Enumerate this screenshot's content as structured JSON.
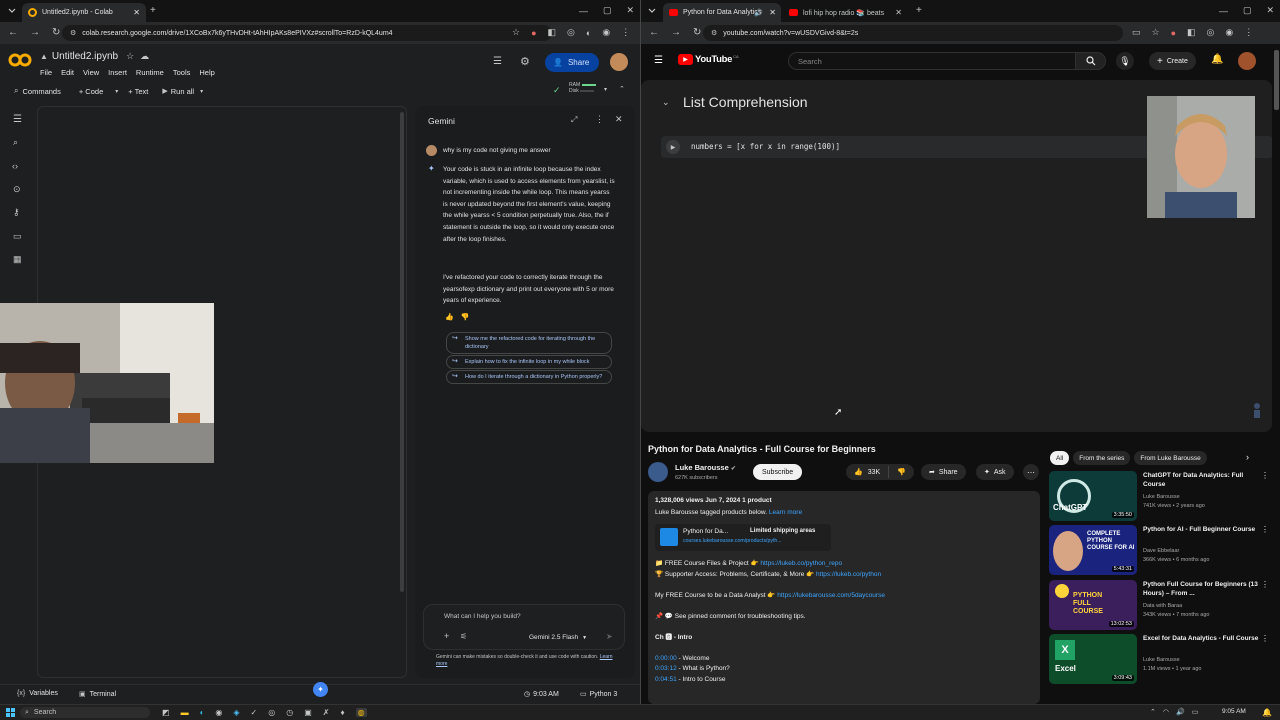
{
  "left_browser": {
    "tabs": [
      {
        "label": "Untitled2.ipynb - Colab"
      }
    ],
    "url": "colab.research.google.com/drive/1XCoBx7k6yTHvDHt-tAhHIpAKs8ePIVXz#scrollTo=RzD-kQL4um4",
    "colab": {
      "filename": "Untitled2.ipynb",
      "menu": [
        "File",
        "Edit",
        "View",
        "Insert",
        "Runtime",
        "Tools",
        "Help"
      ],
      "share_label": "Share",
      "toolbar": {
        "commands": "Commands",
        "code": "+ Code",
        "text": "+ Text",
        "run_all": "Run all"
      },
      "ram_label": "RAM",
      "disk_label": "Disk",
      "status_bar": {
        "variables": "Variables",
        "terminal": "Terminal",
        "time": "9:03 AM",
        "runtime": "Python 3"
      }
    },
    "gemini": {
      "title": "Gemini",
      "user_prompt": "why is my code not giving me answer",
      "response_p1": "Your code is stuck in an infinite loop because the index variable, which is used to access elements from yearslist, is not incrementing inside the while loop. This means yearss is never updated beyond the first element's value, keeping the while yearss < 5 condition perpetually true. Also, the if statement is outside the loop, so it would only execute once after the loop finishes.",
      "response_p2": "I've refactored your code to correctly iterate through the yearsofexp dictionary and print out everyone with 5 or more years of experience.",
      "suggestions": [
        "Show me the refactored code for iterating through the dictionary",
        "Explain how to fix the infinite loop in my while block",
        "How do I iterate through a dictionary in Python properly?"
      ],
      "input_placeholder": "What can I help you build?",
      "model": "Gemini 2.5 Flash",
      "disclaimer": "Gemini can make mistakes so double-check it and use code with caution.",
      "learn_more": "Learn more"
    }
  },
  "right_browser": {
    "tabs": [
      {
        "label": "Python for Data Analytics"
      },
      {
        "label": "lofi hip hop radio 📚 beats"
      }
    ],
    "url": "youtube.com/watch?v=wUSDVGivd-8&t=2s",
    "youtube": {
      "search_placeholder": "Search",
      "create_label": "Create",
      "logo_text": "YouTube",
      "logo_country": "CA",
      "video_heading": "List Comprehension",
      "code_line": "numbers = [x for x in range(100)]",
      "video_title": "Python for Data Analytics - Full Course for Beginners",
      "channel": "Luke Barousse",
      "subscribers": "627K subscribers",
      "subscribe_label": "Subscribe",
      "likes": "33K",
      "share_label": "Share",
      "ask_label": "Ask",
      "views_date": "1,328,006 views  Jun 7, 2024  1 product",
      "products_line": "Luke Barousse tagged products below.",
      "learn_more": "Learn more",
      "product_name": "Python for Da...",
      "product_ship": "Limited shipping areas",
      "product_url": "courses.lukebarousse.com/products/pyth...",
      "desc_lines": [
        {
          "prefix": "📁 FREE Course Files & Project 👉 ",
          "link": "https://lukeb.co/python_repo"
        },
        {
          "prefix": "🏆 Supporter Access: Problems, Certificate, & More 👉 ",
          "link": "https://lukeb.co/python"
        },
        {
          "prefix": "",
          "link": ""
        },
        {
          "prefix": "My FREE Course to be a Data Analyst 👉 ",
          "link": "https://lukebarousse.com/5daycourse"
        },
        {
          "prefix": "",
          "link": ""
        },
        {
          "prefix": "📌 💬 See pinned comment for troubleshooting tips.",
          "link": ""
        }
      ],
      "chapters_heading": "Ch 🅱 - Intro",
      "chapters": [
        {
          "time": "0:00:00",
          "label": " - Welcome"
        },
        {
          "time": "0:03:12",
          "label": " - What is Python?"
        },
        {
          "time": "0:04:51",
          "label": " - Intro to Course"
        }
      ],
      "chips": [
        "All",
        "From the series",
        "From Luke Barousse"
      ],
      "recommendations": [
        {
          "title": "ChatGPT for Data Analytics: Full Course",
          "channel": "Luke Barousse",
          "meta": "741K views • 2 years ago",
          "duration": "3:35:50",
          "thumb_text": "ChatGPT",
          "color": "#0d3b3a"
        },
        {
          "title": "Python for AI - Full Beginner Course",
          "channel": "Dave Ebbelaar",
          "meta": "366K views • 6 months ago",
          "duration": "5:43:31",
          "thumb_text": "COMPLETE PYTHON COURSE FOR AI",
          "color": "#1a237e"
        },
        {
          "title": "Python Full Course for Beginners (13 Hours) – From ...",
          "channel": "Data with Baraa",
          "meta": "343K views • 7 months ago",
          "duration": "13:02:53",
          "thumb_text": "PYTHON FULL COURSE",
          "color": "#3b1f5c"
        },
        {
          "title": "Excel for Data Analytics - Full Course",
          "channel": "Luke Barousse",
          "meta": "1.1M views • 1 year ago",
          "duration": "3:09:43",
          "thumb_text": "Excel",
          "color": "#0e4d2a"
        }
      ]
    }
  },
  "taskbar": {
    "search": "Search",
    "time": "9:05 AM"
  },
  "colors": {
    "accent_blue": "#a8c7fa",
    "yt_red": "#ff0000",
    "share_blue": "#0b57d0"
  }
}
